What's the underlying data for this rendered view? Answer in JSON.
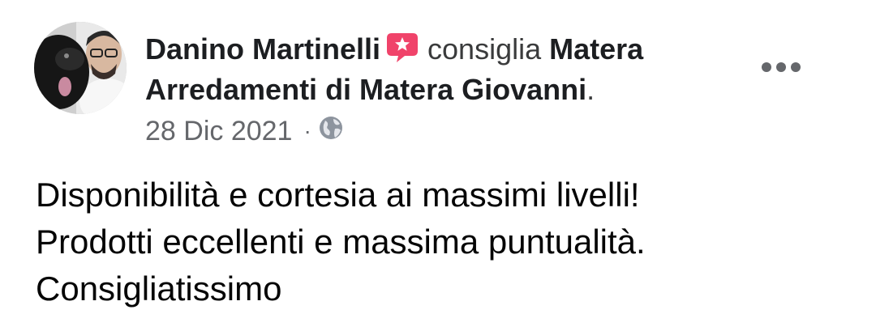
{
  "post": {
    "author": "Danino Martinelli",
    "action": "consiglia",
    "page_name": "Matera Arredamenti di Matera Giovanni",
    "page_name_suffix": ".",
    "date": "28 Dic 2021",
    "separator": "·",
    "audience_icon": "globe-icon",
    "recommend_icon": "recommend-star-badge-icon",
    "more_icon": "more-options-icon",
    "body_lines": [
      "Disponibilità e cortesia ai massimi livelli!",
      "Prodotti eccellenti e massima puntualità.",
      "Consigliatissimo"
    ]
  },
  "colors": {
    "recommend_badge": "#f0436a",
    "text_primary": "#050505",
    "text_secondary": "#65676b"
  }
}
